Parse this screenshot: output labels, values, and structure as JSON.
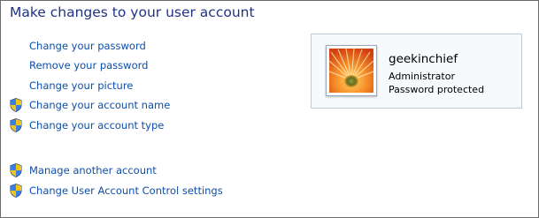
{
  "page_title": "Make changes to your user account",
  "tasks": [
    {
      "label": "Change your password",
      "icon": "none"
    },
    {
      "label": "Remove your password",
      "icon": "none"
    },
    {
      "label": "Change your picture",
      "icon": "none"
    },
    {
      "label": "Change your account name",
      "icon": "uac-shield-icon"
    },
    {
      "label": "Change your account type",
      "icon": "uac-shield-icon"
    },
    {
      "label": "Manage another account",
      "icon": "uac-shield-icon"
    },
    {
      "label": "Change User Account Control settings",
      "icon": "uac-shield-icon"
    }
  ],
  "account": {
    "username": "geekinchief",
    "role": "Administrator",
    "status": "Password protected",
    "picture": "orange-flower"
  },
  "colors": {
    "title": "#1e3287",
    "link": "#0d4eab",
    "card_border": "#b6cde4",
    "card_bg": "#f7fafd"
  }
}
